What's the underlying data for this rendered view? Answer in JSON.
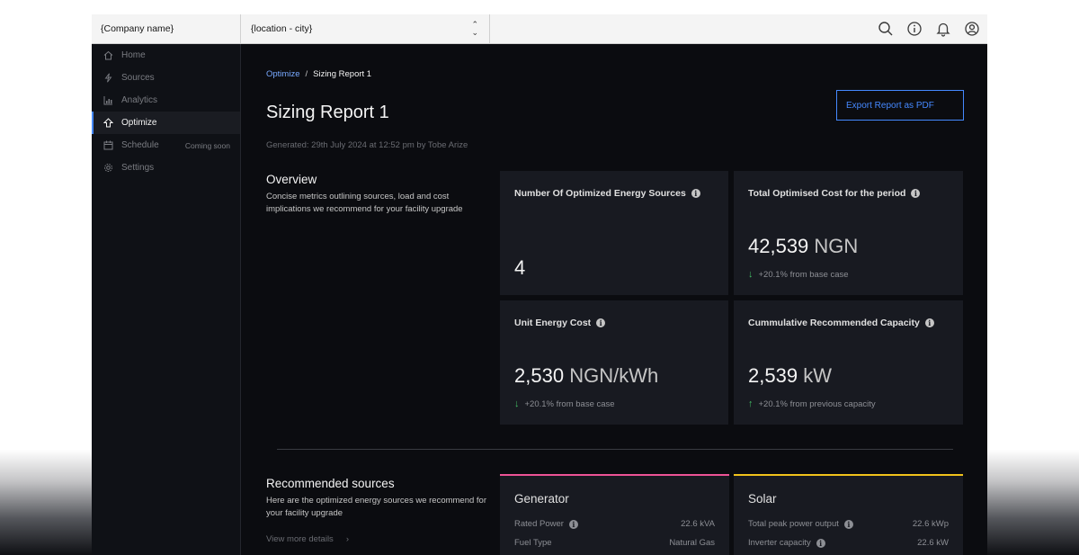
{
  "header": {
    "company": "{Company name}",
    "location": "{location - city}"
  },
  "sidebar": {
    "items": [
      {
        "label": "Home",
        "icon": "home-icon"
      },
      {
        "label": "Sources",
        "icon": "bolt-icon"
      },
      {
        "label": "Analytics",
        "icon": "chart-icon"
      },
      {
        "label": "Optimize",
        "icon": "optimize-icon",
        "active": true
      },
      {
        "label": "Schedule",
        "icon": "calendar-icon",
        "badge": "Coming soon"
      },
      {
        "label": "Settings",
        "icon": "gear-icon"
      }
    ]
  },
  "breadcrumb": {
    "parent": "Optimize",
    "separator": "/",
    "current": "Sizing Report 1"
  },
  "page": {
    "title": "Sizing Report 1",
    "subtitle": "Generated: 29th July 2024 at 12:52 pm by Tobe Arize",
    "export_label": "Export Report as PDF"
  },
  "overview": {
    "title": "Overview",
    "description": "Concise metrics outlining sources, load and cost implications we recommend for your facility upgrade",
    "cards": [
      {
        "label": "Number Of Optimized Energy Sources",
        "value": "4",
        "unit": "",
        "delta": ""
      },
      {
        "label": "Total Optimised Cost for the period",
        "value": "42,539",
        "unit": "NGN",
        "delta": "+20.1% from base case",
        "direction": "down"
      },
      {
        "label": "Unit Energy Cost",
        "value": "2,530",
        "unit": "NGN/kWh",
        "delta": "+20.1% from base case",
        "direction": "down"
      },
      {
        "label": "Cummulative Recommended Capacity",
        "value": "2,539",
        "unit": "kW",
        "delta": "+20.1% from previous capacity",
        "direction": "up"
      }
    ]
  },
  "recommended": {
    "title": "Recommended sources",
    "description": "Here are the optimized energy sources we recommend for your facility upgrade",
    "view_more": "View more details",
    "sources": [
      {
        "name": "Generator",
        "accent": "#ee5396",
        "rows": [
          {
            "label": "Rated Power",
            "value": "22.6 kVA"
          },
          {
            "label": "Fuel Type",
            "value": "Natural Gas"
          }
        ]
      },
      {
        "name": "Solar",
        "accent": "#f1c21b",
        "rows": [
          {
            "label": "Total peak power output",
            "value": "22.6 kWp"
          },
          {
            "label": "Inverter capacity",
            "value": "22.6 kW"
          }
        ]
      }
    ]
  },
  "colors": {
    "accent_blue": "#4589ff",
    "positive_green": "#42be65",
    "generator_pink": "#ee5396",
    "solar_yellow": "#f1c21b",
    "background": "#0b0c10"
  }
}
